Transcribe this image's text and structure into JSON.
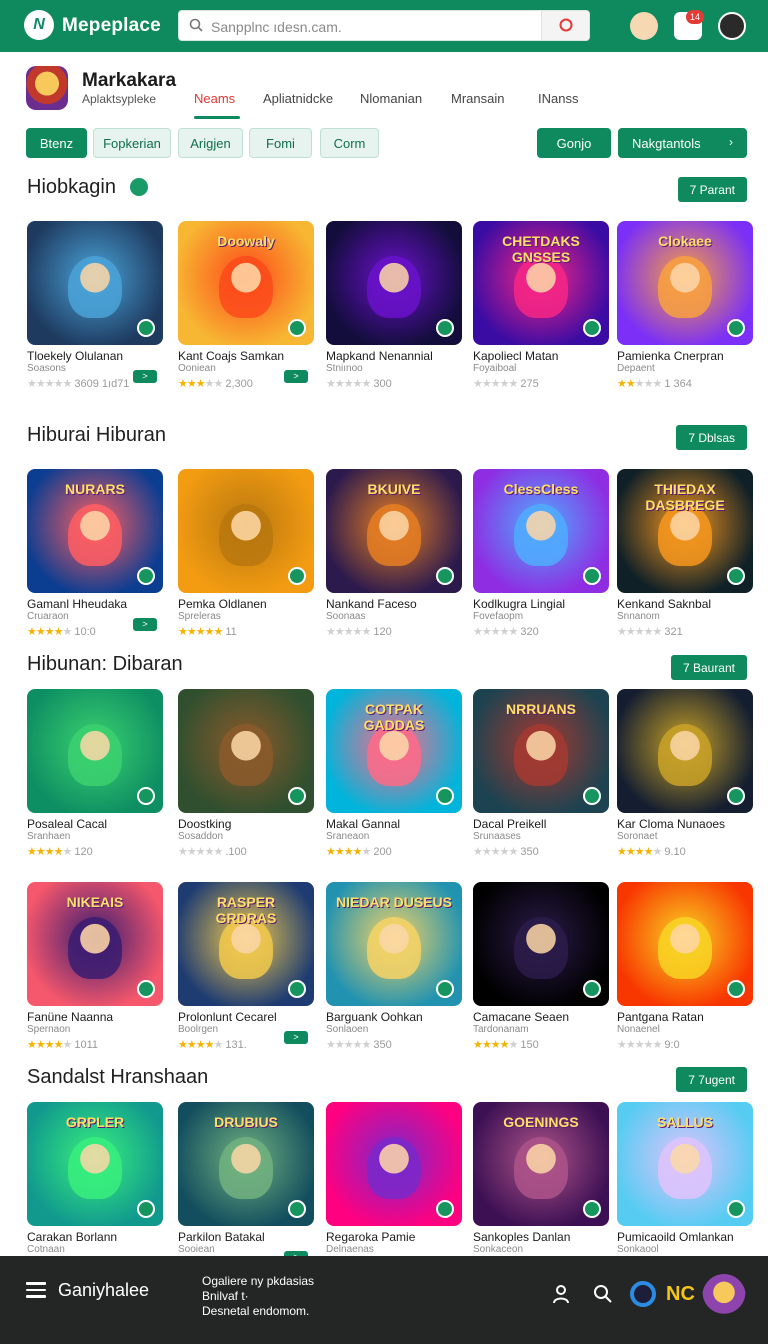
{
  "topbar": {
    "brand": "Mepeplace",
    "search_placeholder": "Sanpplnc ıdesn.cam.",
    "badge_count": "14",
    "colors": {
      "bar": "#0f8a5f"
    }
  },
  "app": {
    "title": "Markakara",
    "subtitle": "Aplaktsypleke"
  },
  "nav_tabs": [
    {
      "label": "Neams",
      "active": true
    },
    {
      "label": "Apliatnidcke"
    },
    {
      "label": "Nlomanian"
    },
    {
      "label": "Mransain"
    },
    {
      "label": "INanss"
    }
  ],
  "chips": [
    {
      "label": "Btenz",
      "active": true
    },
    {
      "label": "Fopkerian"
    },
    {
      "label": "Arigjen"
    },
    {
      "label": "Fomi"
    },
    {
      "label": "Corm"
    }
  ],
  "actions": {
    "primary": "Gonjo",
    "secondary": "Nakgtantols"
  },
  "sections": [
    {
      "title": "Hiobkagin",
      "button": "7 Parant",
      "cards": [
        {
          "name": "Tloekely Olulanan",
          "dev": "Soasons",
          "rating_text": "3609 1ıd71",
          "stars": 0,
          "mini": ">",
          "art_text": ""
        },
        {
          "name": "Kant Coajs Samkan",
          "dev": "Ooniean",
          "rating_text": "2,300",
          "stars": 3,
          "mini": ">",
          "art_text": "Doowaly"
        },
        {
          "name": "Mapkand Nenannial",
          "dev": "Stniınoo",
          "rating_text": "300",
          "stars": 0,
          "mini": "",
          "art_text": ""
        },
        {
          "name": "Kapoliecl Matan",
          "dev": "Foyaiboal",
          "rating_text": "275",
          "stars": 0,
          "mini": "",
          "art_text": "CHETDAKS GNSSES"
        },
        {
          "name": "Pamienka Cnerpran",
          "dev": "Depaent",
          "rating_text": "1 364",
          "stars": 2,
          "mini": "",
          "art_text": "Clokaee"
        }
      ]
    },
    {
      "title": "Hiburai Hiburan",
      "button": "7 Dblsas",
      "cards": [
        {
          "name": "Gamanl Hheudaka",
          "dev": "Cruaraon",
          "rating_text": "10:0",
          "stars": 4,
          "mini": ">",
          "art_text": "NURARS"
        },
        {
          "name": "Pemka Oldlanen",
          "dev": "Spreleras",
          "rating_text": "11",
          "stars": 5,
          "mini": "",
          "art_text": ""
        },
        {
          "name": "Nankand Faceso",
          "dev": "Soonaas",
          "rating_text": "120",
          "stars": 0,
          "mini": "",
          "art_text": "BKUIVE"
        },
        {
          "name": "Kodlkugra Lingial",
          "dev": "Fovefaopm",
          "rating_text": "320",
          "stars": 0,
          "mini": "",
          "art_text": "ClessCless"
        },
        {
          "name": "Kenkand Saknbal",
          "dev": "Snnanom",
          "rating_text": "321",
          "stars": 0,
          "mini": "",
          "art_text": "THIEDAX DASBREGE"
        }
      ]
    },
    {
      "title": "Hibunan: Dibaran",
      "button": "7 Baurant",
      "cards": [
        {
          "name": "Posaleal Cacal",
          "dev": "Sranhaen",
          "rating_text": "120",
          "stars": 4,
          "mini": "",
          "art_text": ""
        },
        {
          "name": "Doostking",
          "dev": "Sosaddon",
          "rating_text": ".100",
          "stars": 0,
          "mini": "",
          "art_text": ""
        },
        {
          "name": "Makal Gannal",
          "dev": "Sraneaon",
          "rating_text": "200",
          "stars": 4,
          "mini": "",
          "art_text": "COTPAK GADDAS"
        },
        {
          "name": "Dacal Preikell",
          "dev": "Srunaases",
          "rating_text": "350",
          "stars": 0,
          "mini": "",
          "art_text": "NRRUANS"
        },
        {
          "name": "Kar Cloma Nunaoes",
          "dev": "Soronaet",
          "rating_text": "9.10",
          "stars": 4,
          "mini": "",
          "art_text": ""
        }
      ]
    },
    {
      "title": "",
      "button": "",
      "cards": [
        {
          "name": "Fanüne Naanna",
          "dev": "Spernaon",
          "rating_text": "1011",
          "stars": 4,
          "mini": "",
          "art_text": "NIKEAIS"
        },
        {
          "name": "Prolonlunt Cecarel",
          "dev": "Boolrgen",
          "rating_text": "131.",
          "stars": 4,
          "mini": ">",
          "art_text": "RASPER GRDRAS"
        },
        {
          "name": "Barguank Oohkan",
          "dev": "Sonlaoen",
          "rating_text": "350",
          "stars": 0,
          "mini": "",
          "art_text": "NIEDAR DUSEUS"
        },
        {
          "name": "Camacane Seaen",
          "dev": "Tardonanam",
          "rating_text": "150",
          "stars": 4,
          "mini": "",
          "art_text": ""
        },
        {
          "name": "Pantgana Ratan",
          "dev": "Nonaenel",
          "rating_text": "9:0",
          "stars": 0,
          "mini": "",
          "art_text": ""
        }
      ]
    },
    {
      "title": "Sandalst Hranshaan",
      "button": "7 7ugent",
      "cards": [
        {
          "name": "Carakan Borlann",
          "dev": "Cotnaan",
          "rating_text": "",
          "stars": -1,
          "mini": "",
          "art_text": "GRPLER"
        },
        {
          "name": "Parkilon Batakal",
          "dev": "Sooiean",
          "rating_text": "",
          "stars": -1,
          "mini": ">",
          "art_text": "DRUBIUS"
        },
        {
          "name": "Regaroka Pamie",
          "dev": "Delnaenas",
          "rating_text": "",
          "stars": -1,
          "mini": "",
          "art_text": ""
        },
        {
          "name": "Sankoples Danlan",
          "dev": "Sonkaceon",
          "rating_text": "",
          "stars": -1,
          "mini": "",
          "art_text": "GOENINGS"
        },
        {
          "name": "Pumicaoild Omlankan",
          "dev": "Sonkaool",
          "rating_text": "",
          "stars": -1,
          "mini": "",
          "art_text": "SALLUS"
        }
      ]
    }
  ],
  "bottombar": {
    "title": "Ganiyhalee",
    "line1": "Ogaliere ny pkdasias",
    "line2": "Bnilvaf t·",
    "line3": "Desnetal endomom.",
    "logo_text": "NC"
  }
}
